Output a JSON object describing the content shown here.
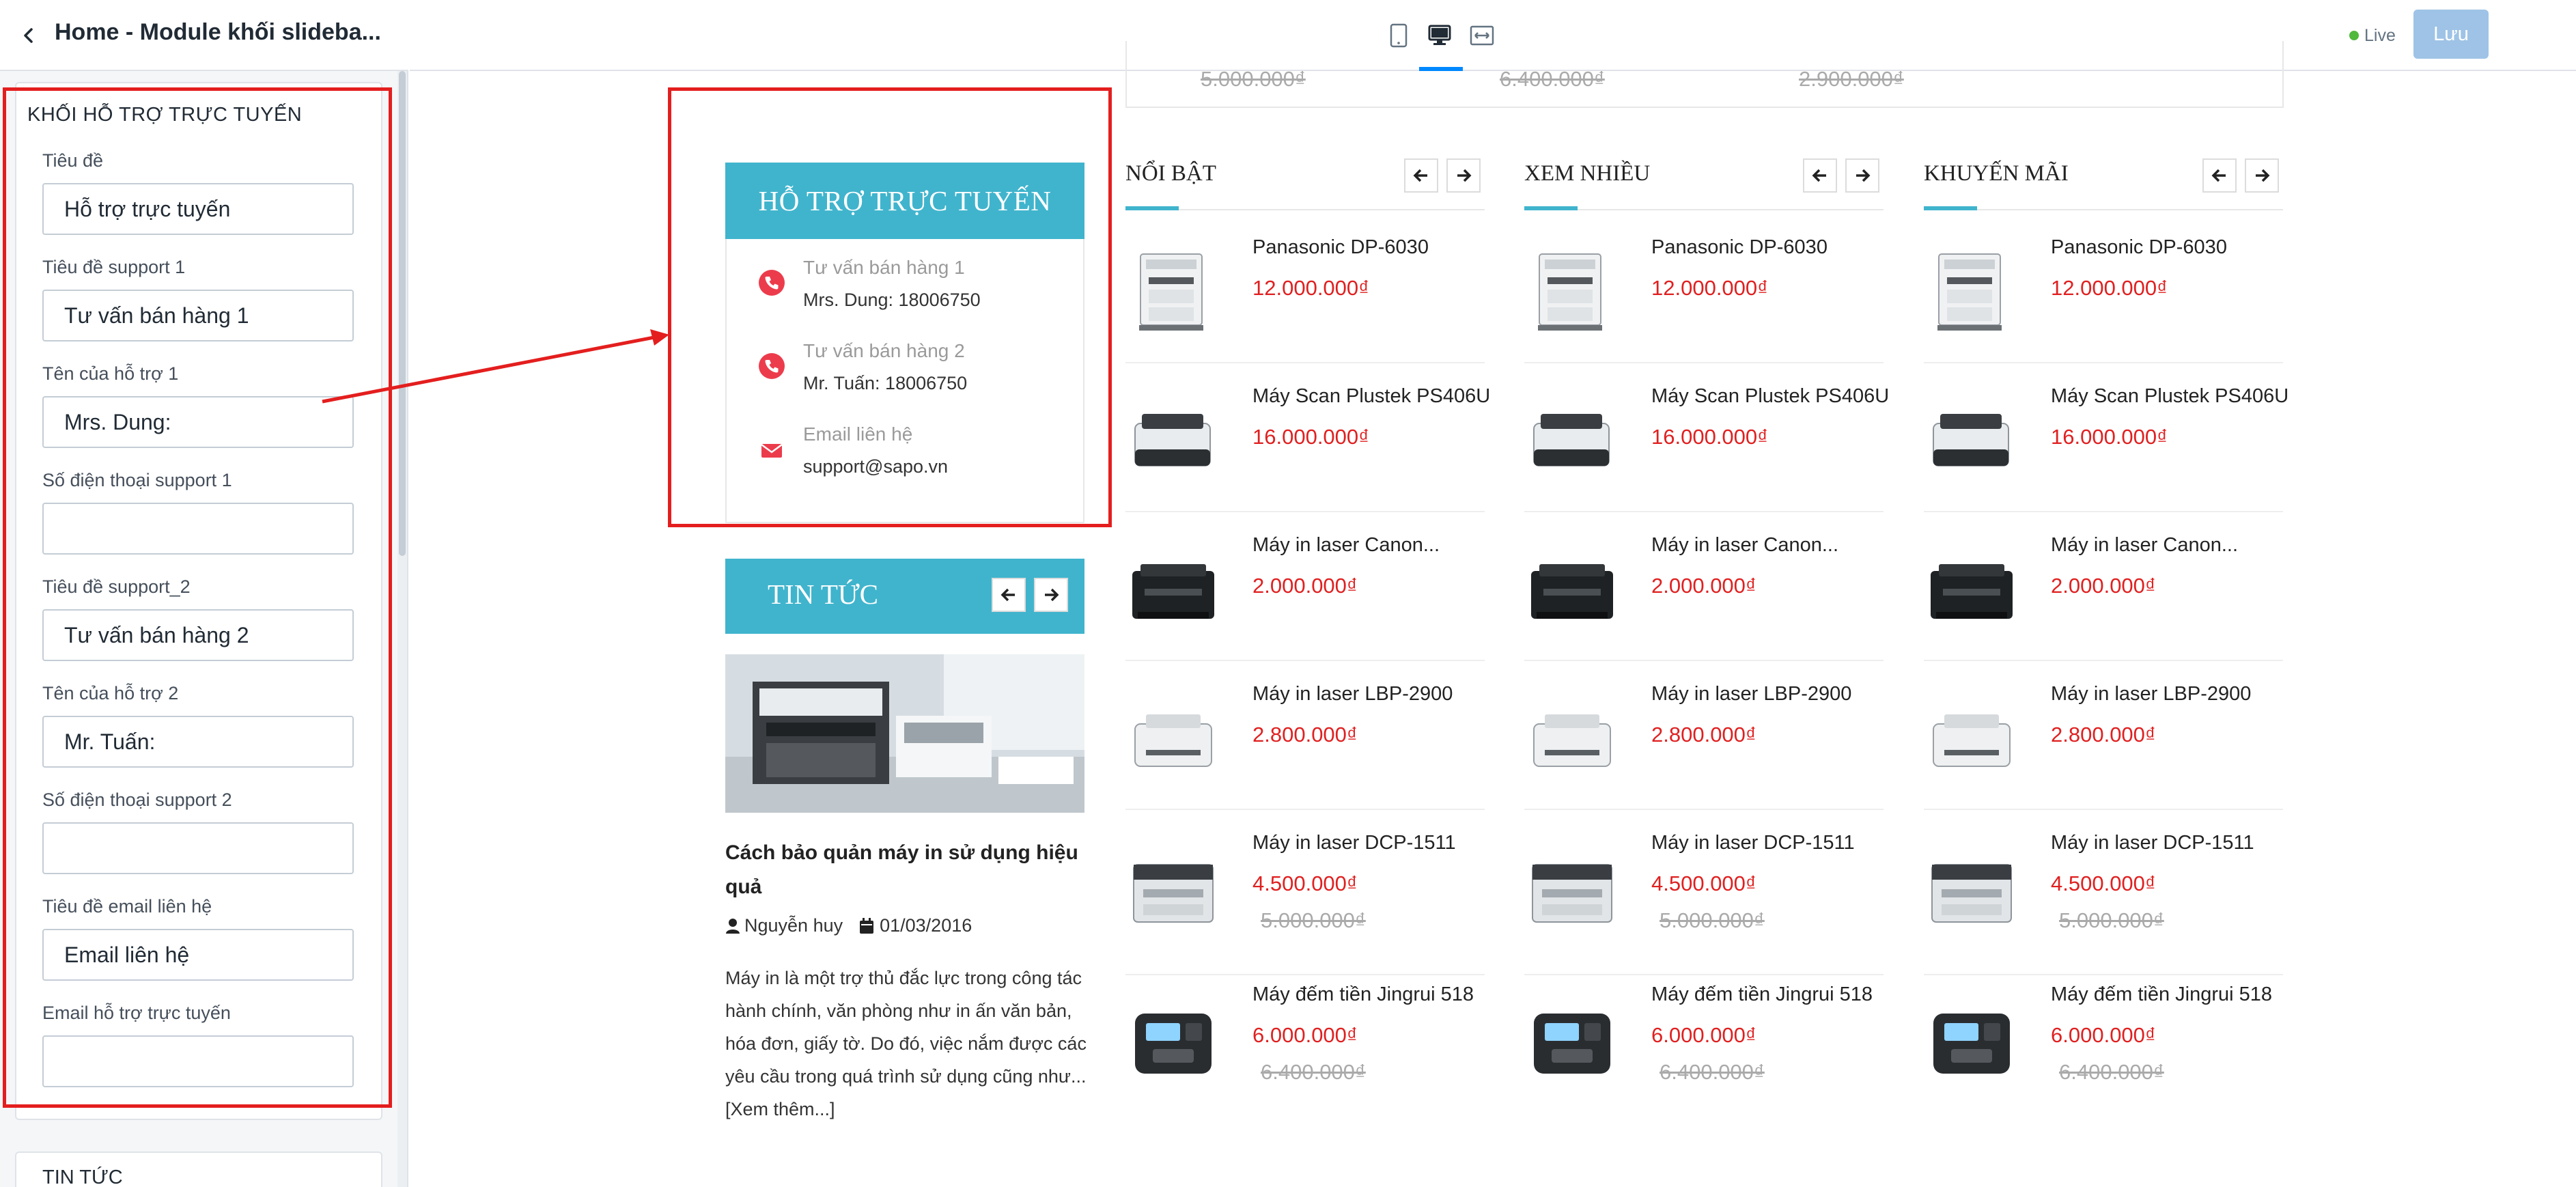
{
  "sidebar": {
    "title": "Home - Module khối slideba...",
    "section_title": "KHỐI HỖ TRỢ TRỰC TUYẾN",
    "fields": [
      {
        "label": "Tiêu đề",
        "value": ""
      },
      {
        "label": "Tiêu đề support 1",
        "value": ""
      },
      {
        "label": "Tên của hỗ trợ 1",
        "value": ""
      },
      {
        "label": "Số điện thoại support 1",
        "value": ""
      },
      {
        "label": "Tiêu đề support_2",
        "value": ""
      },
      {
        "label": "Tên của hỗ trợ 2",
        "value": ""
      },
      {
        "label": "Số điện thoại support 2",
        "value": ""
      },
      {
        "label": "Tiêu đề email liên hệ",
        "value": ""
      },
      {
        "label": "Email hỗ trợ trực tuyến",
        "value": ""
      }
    ],
    "values": [
      "Hỗ trợ trực tuyến",
      "Tư vấn bán hàng 1",
      "Mrs. Dung:",
      "",
      "Tư vấn bán hàng 2",
      "Mr. Tuấn:",
      "",
      "Email liên hệ",
      ""
    ],
    "next_section_title": "TIN TỨC"
  },
  "toolbar": {
    "device_icons": [
      "tablet-icon",
      "desktop-icon",
      "full-width-icon"
    ],
    "selected_device": "desktop",
    "live_label": "Live",
    "save_label": "Lưu"
  },
  "colors": {
    "accent": "#40b4cd",
    "price": "#e02020",
    "highlight_frame": "#e41e1e",
    "live": "#50b83c",
    "save_button": "#9ec3e6"
  },
  "preview": {
    "top_old_prices": [
      "5.000.000₫",
      "6.400.000₫",
      "2.900.000₫"
    ],
    "support": {
      "title": "HỖ TRỢ TRỰC TUYẾN",
      "items": [
        {
          "icon": "phone-icon",
          "title": "Tư vấn bán hàng 1",
          "value": "Mrs. Dung: 18006750"
        },
        {
          "icon": "phone-icon",
          "title": "Tư vấn bán hàng 2",
          "value": "Mr. Tuấn: 18006750"
        },
        {
          "icon": "email-icon",
          "title": "Email liên hệ",
          "value": "support@sapo.vn"
        }
      ]
    },
    "news": {
      "title": "TIN TỨC",
      "article_title": "Cách bảo quản máy in sử dụng hiệu quả",
      "author": "Nguyễn huy",
      "date": "01/03/2016",
      "excerpt": "Máy in là một trợ thủ đắc lực trong công tác hành chính, văn phòng như in ấn văn bản, hóa đơn, giấy tờ. Do đó, việc nắm được các yêu cầu trong quá trình sử dụng cũng như... [Xem thêm...]"
    },
    "columns": [
      {
        "title": "NỔI BẬT"
      },
      {
        "title": "XEM NHIỀU"
      },
      {
        "title": "KHUYẾN MÃI"
      }
    ],
    "products": [
      {
        "name": "Panasonic DP-6030",
        "price": "12.000.000₫",
        "old_price": "",
        "image": "copier-icon"
      },
      {
        "name": "Máy Scan Plustek PS406U",
        "price": "16.000.000₫",
        "old_price": "",
        "image": "scanner-icon"
      },
      {
        "name": "Máy in laser Canon...",
        "price": "2.000.000₫",
        "old_price": "",
        "image": "laser-printer-icon"
      },
      {
        "name": "Máy in laser LBP-2900",
        "price": "2.800.000₫",
        "old_price": "",
        "image": "printer-icon"
      },
      {
        "name": "Máy in laser DCP-1511",
        "price": "4.500.000₫",
        "old_price": "5.000.000₫",
        "image": "mfp-printer-icon"
      },
      {
        "name": "Máy đếm tiền Jingrui 518",
        "price": "6.000.000₫",
        "old_price": "6.400.000₫",
        "image": "money-counter-icon"
      }
    ]
  }
}
